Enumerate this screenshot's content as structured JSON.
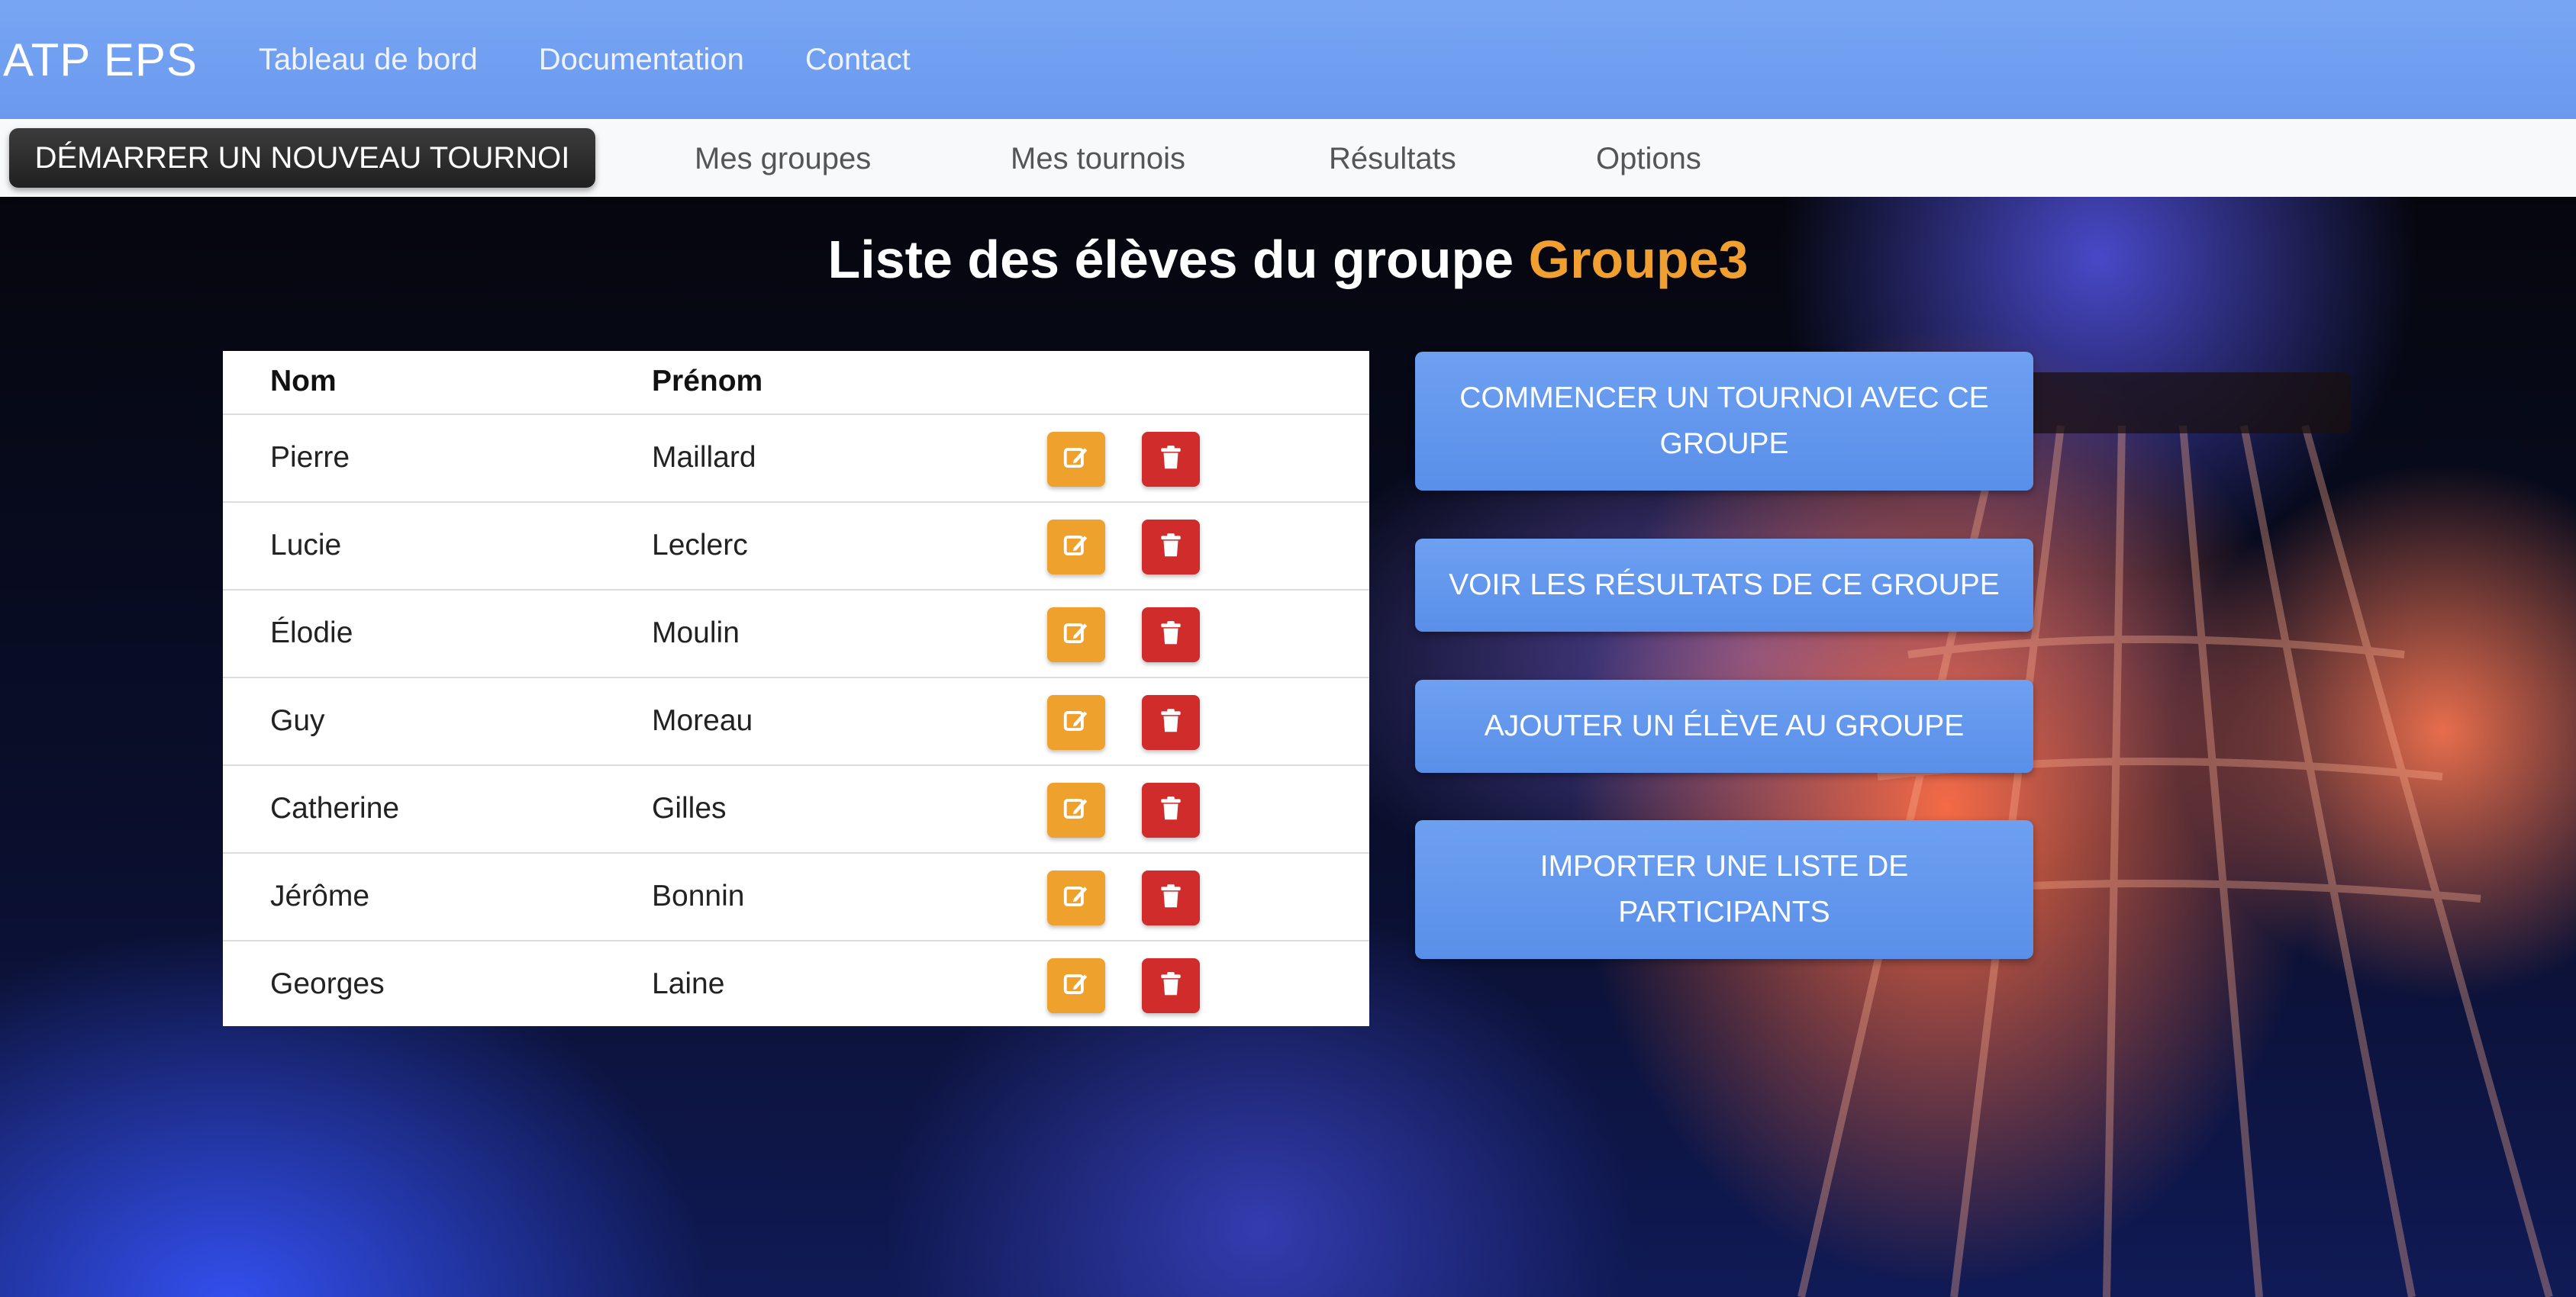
{
  "navbar": {
    "brand": "ATP EPS",
    "links": [
      "Tableau de bord",
      "Documentation",
      "Contact"
    ]
  },
  "subnav": {
    "start_button": "DÉMARRER UN NOUVEAU TOURNOI",
    "links": [
      "Mes groupes",
      "Mes tournois",
      "Résultats",
      "Options"
    ]
  },
  "page": {
    "title_prefix": "Liste des élèves du groupe ",
    "group_name": "Groupe3"
  },
  "table": {
    "headers": [
      "Nom",
      "Prénom"
    ],
    "rows": [
      {
        "nom": "Pierre",
        "prenom": "Maillard"
      },
      {
        "nom": "Lucie",
        "prenom": "Leclerc"
      },
      {
        "nom": "Élodie",
        "prenom": "Moulin"
      },
      {
        "nom": "Guy",
        "prenom": "Moreau"
      },
      {
        "nom": "Catherine",
        "prenom": "Gilles"
      },
      {
        "nom": "Jérôme",
        "prenom": "Bonnin"
      },
      {
        "nom": "Georges",
        "prenom": "Laine"
      }
    ],
    "edit_icon": "pencil-square-icon",
    "delete_icon": "trash-icon"
  },
  "actions": {
    "start_tournament": "COMMENCER UN TOURNOI AVEC CE GROUPE",
    "view_results": "VOIR LES RÉSULTATS DE CE GROUPE",
    "add_student": "AJOUTER UN ÉLÈVE AU GROUPE",
    "import_list": "IMPORTER UNE LISTE DE PARTICIPANTS"
  },
  "colors": {
    "navbar": "#6a99ef",
    "accent": "#f0a030",
    "edit": "#eea12c",
    "delete": "#d12c2c",
    "action_button": "#6097ee"
  }
}
